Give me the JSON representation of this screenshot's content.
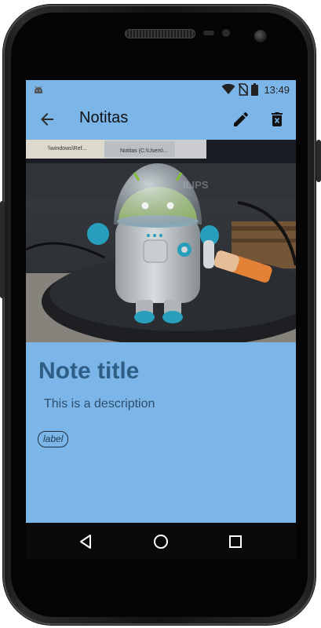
{
  "status_bar": {
    "time": "13:49",
    "icons": [
      "android-debug-icon",
      "wifi-icon",
      "no-sim-icon",
      "battery-icon"
    ]
  },
  "app_bar": {
    "title": "Notitas",
    "icons": [
      "back-arrow-icon",
      "edit-pencil-icon",
      "delete-trash-icon"
    ]
  },
  "note": {
    "title": "Note title",
    "description": "This is a description",
    "label": "label",
    "image_subject": "android-figurine-photo"
  },
  "nav_bar": {
    "icons": [
      "nav-back-triangle-icon",
      "nav-home-circle-icon",
      "nav-recent-square-icon"
    ]
  },
  "colors": {
    "screen_background": "#7cb5e8",
    "title_color": "#2f5f86",
    "description_color": "#2d4f6c",
    "nav_bar": "#0a0a0a"
  }
}
